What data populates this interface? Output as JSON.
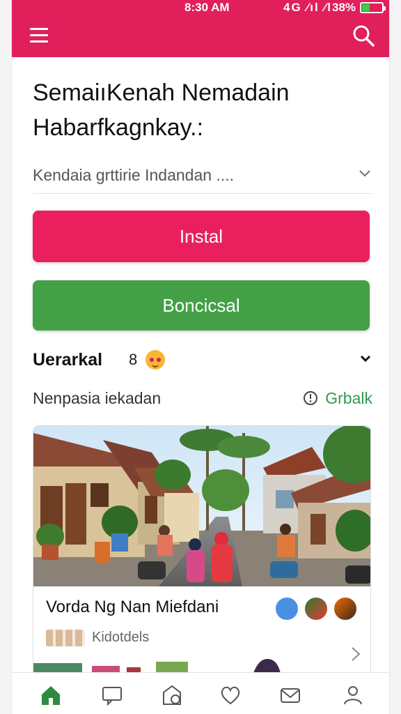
{
  "status_bar": {
    "time": "8:30 AM",
    "signal": "4G ⁄ıl ⁄l",
    "battery_percent": "38%",
    "battery_level": 0.38,
    "battery_color": "#39d04a"
  },
  "header": {
    "background_color": "#e01f5b",
    "menu_icon": "hamburger-menu-icon",
    "search_icon": "search-icon"
  },
  "page": {
    "title_line1": "SemaiıKenah Nemadain",
    "title_line2": "Habarfkagnkay.:"
  },
  "selector": {
    "value": "Kendaia grttirie Indandan ...."
  },
  "buttons": {
    "install_label": "Instal",
    "install_color": "#e91f5e",
    "secondary_label": "Boncicsal",
    "secondary_color": "#43a047"
  },
  "section": {
    "label": "Uerarkal",
    "emoji": "8"
  },
  "subheader": {
    "text": "Nenpasia iekadan",
    "link_label": "Grbalk"
  },
  "card": {
    "title": "Vorda Ng Nan Miefdani",
    "meta_text": "Kidotdels"
  },
  "bottom_nav": {
    "items": [
      "home-icon",
      "chat-icon",
      "photo-icon",
      "heart-icon",
      "mail-icon",
      "profile-icon"
    ],
    "active_color": "#2e8b3e"
  }
}
